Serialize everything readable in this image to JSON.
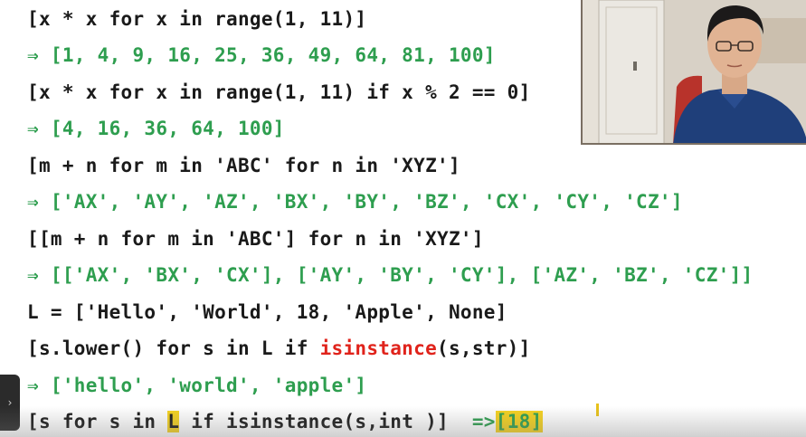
{
  "lines": {
    "l1": "[x * x for x in range(1, 11)]",
    "l2": "⇒ [1, 4, 9, 16, 25, 36, 49, 64, 81, 100]",
    "l3": "[x * x for x in range(1, 11) if x % 2 == 0]",
    "l4": "⇒ [4, 16, 36, 64, 100]",
    "l5": "[m + n for m in 'ABC' for n in 'XYZ']",
    "l6": "⇒ ['AX', 'AY', 'AZ', 'BX', 'BY', 'BZ', 'CX', 'CY', 'CZ']",
    "l7": "[[m + n for m in 'ABC'] for n in 'XYZ']",
    "l8": "⇒ [['AX', 'BX', 'CX'], ['AY', 'BY', 'CY'], ['AZ', 'BZ', 'CZ']]",
    "l9": "L = ['Hello', 'World', 18, 'Apple', None]",
    "l10": {
      "before": "[s.lower() for s in L if ",
      "highlight": "isinstance",
      "after": "(s,str)]"
    },
    "l11": "⇒ ['hello', 'world', 'apple']",
    "l12": {
      "p1": "[s for s in ",
      "var": "L",
      "p2": " if isinstance(s,int )]  ",
      "arrow": "=>",
      "result": "[18]"
    }
  },
  "side_tab": {
    "icon": "chevron-right-icon",
    "glyph": "›"
  },
  "colors": {
    "code": "#1a1a1a",
    "result": "#2e9e4f",
    "keyword_highlight": "#e0231b",
    "marker": "#f5d21f"
  }
}
